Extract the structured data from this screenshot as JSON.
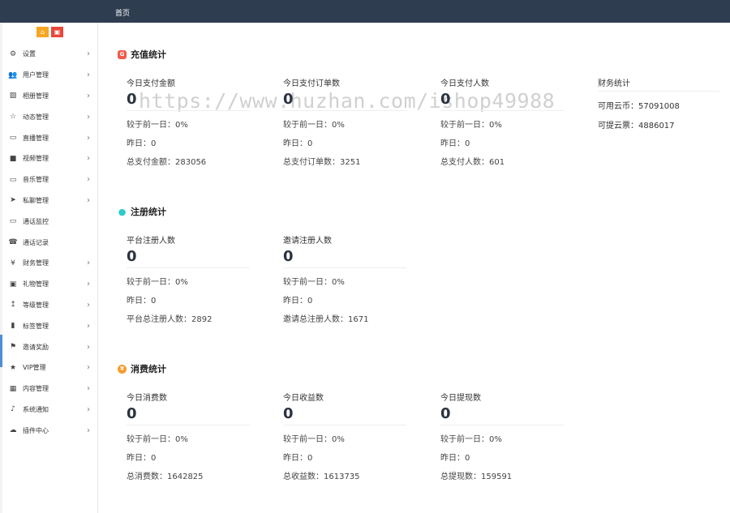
{
  "topbar": {
    "tab_home": "首页"
  },
  "sidebar": {
    "quick_home_icon": "home-icon",
    "quick_shop_icon": "shop-icon",
    "items": [
      {
        "label": "设置",
        "icon": "gear-icon",
        "arrow": true
      },
      {
        "label": "用户管理",
        "icon": "users-icon",
        "arrow": true
      },
      {
        "label": "相册管理",
        "icon": "image-icon",
        "arrow": true
      },
      {
        "label": "动态管理",
        "icon": "star-icon",
        "arrow": true
      },
      {
        "label": "直播管理",
        "icon": "monitor-icon",
        "arrow": true
      },
      {
        "label": "视频管理",
        "icon": "video-icon",
        "arrow": true
      },
      {
        "label": "音乐管理",
        "icon": "monitor-icon",
        "arrow": true
      },
      {
        "label": "私聊管理",
        "icon": "telegram-icon",
        "arrow": true
      },
      {
        "label": "通话监控",
        "icon": "monitor-icon",
        "arrow": false
      },
      {
        "label": "通话记录",
        "icon": "phone-icon",
        "arrow": false
      },
      {
        "label": "财务管理",
        "icon": "yen-icon",
        "arrow": true
      },
      {
        "label": "礼物管理",
        "icon": "gift-icon",
        "arrow": true
      },
      {
        "label": "等级管理",
        "icon": "level-icon",
        "arrow": true
      },
      {
        "label": "标签管理",
        "icon": "bookmark-icon",
        "arrow": true
      },
      {
        "label": "邀请奖励",
        "icon": "sitemap-icon",
        "arrow": true
      },
      {
        "label": "VIP管理",
        "icon": "star-filled-icon",
        "arrow": true
      },
      {
        "label": "内容管理",
        "icon": "grid-icon",
        "arrow": true
      },
      {
        "label": "系统通知",
        "icon": "bell-icon",
        "arrow": true
      },
      {
        "label": "插件中心",
        "icon": "cloud-icon",
        "arrow": true
      }
    ]
  },
  "watermark": "https://www.huzhan.com/ishop49988",
  "recharge": {
    "title": "充值统计",
    "cards": [
      {
        "label": "今日支付金额",
        "value": "0",
        "compare": "较于前一日：0%",
        "yesterday": "昨日：0",
        "total": "总支付金额：283056"
      },
      {
        "label": "今日支付订单数",
        "value": "0",
        "compare": "较于前一日：0%",
        "yesterday": "昨日：0",
        "total": "总支付订单数：3251"
      },
      {
        "label": "今日支付人数",
        "value": "0",
        "compare": "较于前一日：0%",
        "yesterday": "昨日：0",
        "total": "总支付人数：601"
      }
    ],
    "finance": {
      "title": "财务统计",
      "coins": "可用云币：57091008",
      "withdrawable": "可提云票：4886017"
    }
  },
  "register": {
    "title": "注册统计",
    "cards": [
      {
        "label": "平台注册人数",
        "value": "0",
        "compare": "较于前一日：0%",
        "yesterday": "昨日：0",
        "total": "平台总注册人数：2892"
      },
      {
        "label": "邀请注册人数",
        "value": "0",
        "compare": "较于前一日：0%",
        "yesterday": "昨日：0",
        "total": "邀请总注册人数：1671"
      }
    ]
  },
  "consume": {
    "title": "消费统计",
    "cards": [
      {
        "label": "今日消费数",
        "value": "0",
        "compare": "较于前一日：0%",
        "yesterday": "昨日：0",
        "total": "总消费数：1642825"
      },
      {
        "label": "今日收益数",
        "value": "0",
        "compare": "较于前一日：0%",
        "yesterday": "昨日：0",
        "total": "总收益数：1613735"
      },
      {
        "label": "今日提现数",
        "value": "0",
        "compare": "较于前一日：0%",
        "yesterday": "昨日：0",
        "total": "总提现数：159591"
      }
    ]
  }
}
